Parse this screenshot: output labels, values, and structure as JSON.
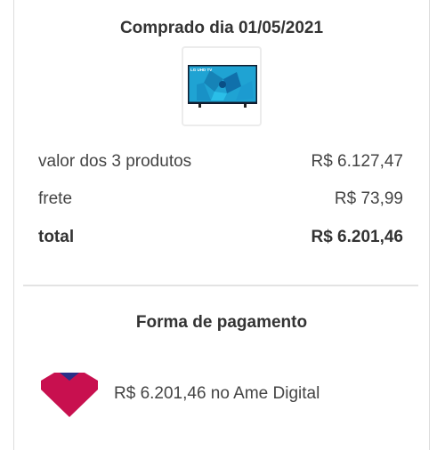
{
  "purchase": {
    "title": "Comprado dia 01/05/2021",
    "product_image": "lg-uhd-tv-thumbnail",
    "tv_brand_text": "LG UHD TV"
  },
  "summary": {
    "products_label": "valor dos 3 produtos",
    "products_value": "R$ 6.127,47",
    "shipping_label": "frete",
    "shipping_value": "R$ 73,99",
    "total_label": "total",
    "total_value": "R$ 6.201,46"
  },
  "payment": {
    "title": "Forma de pagamento",
    "method_icon": "ame-digital-logo",
    "method_text": "R$ 6.201,46 no Ame Digital"
  },
  "colors": {
    "ame_primary": "#c8104f",
    "ame_accent": "#2b2f87",
    "tv_screen": "#1fa3d3"
  }
}
